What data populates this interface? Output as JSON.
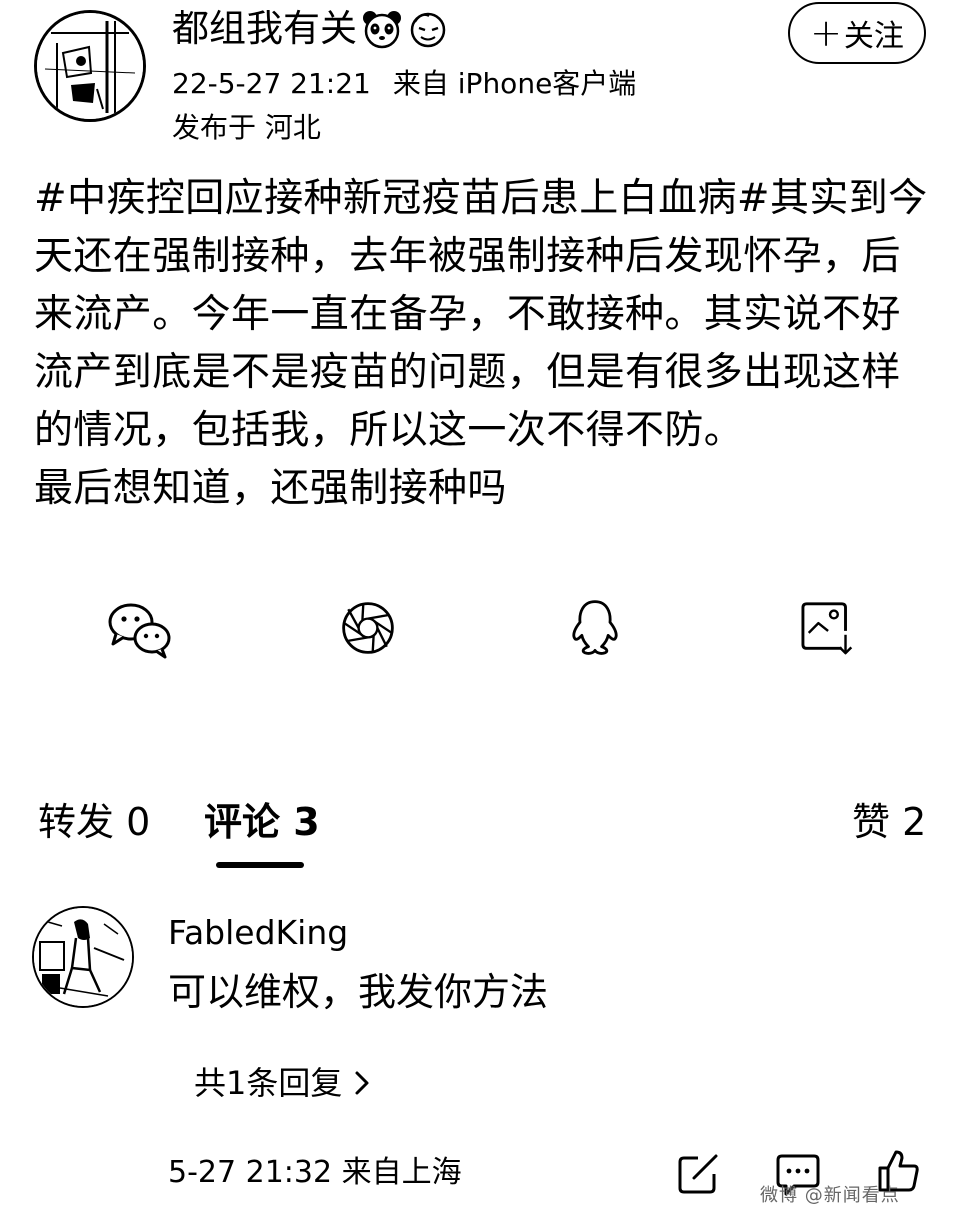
{
  "post": {
    "username": "都组我有关",
    "badges": [
      "panda-icon",
      "face-icon"
    ],
    "time": "22-5-27 21:21",
    "source": "来自 iPhone客户端",
    "location": "发布于 河北",
    "follow_plus": "+",
    "follow_label": "关注",
    "body_lines": [
      "#中疾控回应接种新冠疫苗后患上白血病#其实到今天还在强制接种，去年被强制接种后发现怀孕，后来流产。今年一直在备孕，不敢接种。其实说不好流产到底是不是疫苗的问题，但是有很多出现这样的情况，包括我，所以这一次不得不防。",
      "最后想知道，还强制接种吗"
    ]
  },
  "share_bar": {
    "icons": [
      "wechat-icon",
      "moments-icon",
      "qq-icon",
      "save-image-icon"
    ]
  },
  "tabs": {
    "repost": "转发 0",
    "comments": "评论 3",
    "likes": "赞 2",
    "active": "comments"
  },
  "comment": {
    "username": "FabledKing",
    "text": "可以维权，我发你方法",
    "replies": "共1条回复",
    "time": "5-27 21:32",
    "location": "来自上海",
    "actions": [
      "share-icon",
      "reply-icon",
      "like-icon"
    ]
  },
  "watermark": "微博 @新闻看点"
}
